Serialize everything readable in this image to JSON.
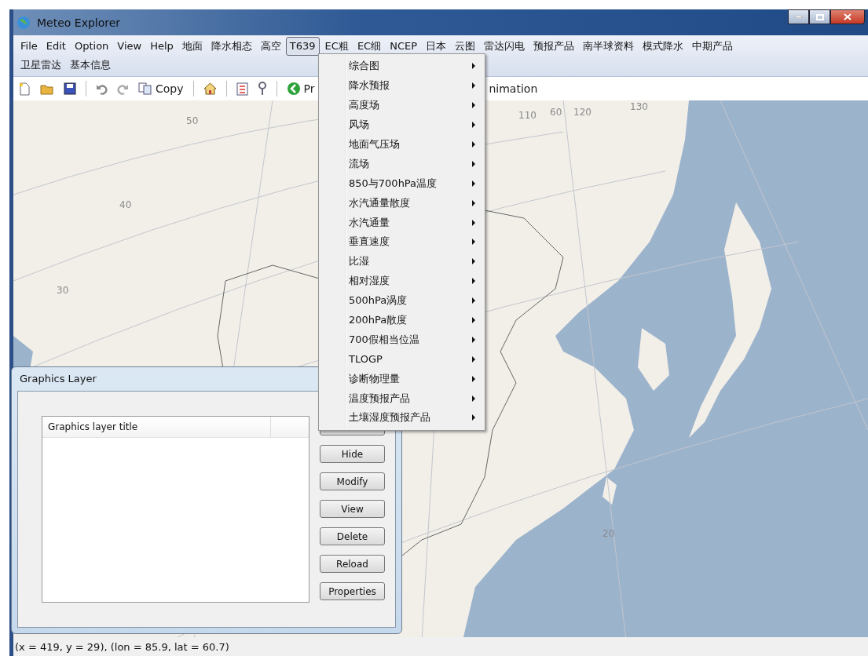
{
  "window": {
    "title": "Meteo Explorer"
  },
  "menu_bar": [
    [
      {
        "label": "File",
        "selected": false
      },
      {
        "label": "Edit",
        "selected": false
      },
      {
        "label": "Option",
        "selected": false
      },
      {
        "label": "View",
        "selected": false
      },
      {
        "label": "Help",
        "selected": false
      },
      {
        "label": "地面",
        "selected": false
      },
      {
        "label": "降水相态",
        "selected": false
      },
      {
        "label": "高空",
        "selected": false
      },
      {
        "label": "T639",
        "selected": true
      },
      {
        "label": "EC粗",
        "selected": false
      },
      {
        "label": "EC细",
        "selected": false
      },
      {
        "label": "NCEP",
        "selected": false
      },
      {
        "label": "日本",
        "selected": false
      },
      {
        "label": "云图",
        "selected": false
      },
      {
        "label": "雷达闪电",
        "selected": false
      },
      {
        "label": "预报产品",
        "selected": false
      },
      {
        "label": "南半球资料",
        "selected": false
      },
      {
        "label": "模式降水",
        "selected": false
      },
      {
        "label": "中期产品",
        "selected": false
      }
    ],
    [
      {
        "label": "卫星雷达",
        "selected": false
      },
      {
        "label": "基本信息",
        "selected": false
      }
    ]
  ],
  "toolbar": [
    {
      "kind": "icon"
    },
    {
      "kind": "icon"
    },
    {
      "kind": "icon"
    },
    {
      "kind": "separator"
    },
    {
      "kind": "icon"
    },
    {
      "kind": "icon"
    },
    {
      "kind": "labeled",
      "label": "Copy"
    },
    {
      "kind": "separator"
    },
    {
      "kind": "icon"
    },
    {
      "kind": "separator"
    },
    {
      "kind": "icon"
    },
    {
      "kind": "icon"
    },
    {
      "kind": "separator"
    },
    {
      "kind": "labeled",
      "label": "Pr"
    },
    {
      "kind": "text",
      "label": "nimation"
    }
  ],
  "dropdown": [
    "综合图",
    "降水预报",
    "高度场",
    "风场",
    "地面气压场",
    "流场",
    "850与700hPa温度",
    "水汽通量散度",
    "水汽通量",
    "垂直速度",
    "比湿",
    "相对湿度",
    "500hPa涡度",
    "200hPa散度",
    "700假相当位温",
    "TLOGP",
    "诊断物理量",
    "温度预报产品",
    "土壤湿度预报产品"
  ],
  "map": {
    "grid_labels": [
      "50",
      "40",
      "30",
      "110",
      "60",
      "120",
      "130",
      "20"
    ]
  },
  "graphics_layer": {
    "title": "Graphics Layer",
    "column": "Graphics layer title",
    "buttons": [
      "Hide",
      "Modify",
      "View",
      "Delete",
      "Reload",
      "Properties"
    ]
  },
  "status_bar": "(x = 419, y = 29), (lon = 85.9, lat = 60.7)"
}
